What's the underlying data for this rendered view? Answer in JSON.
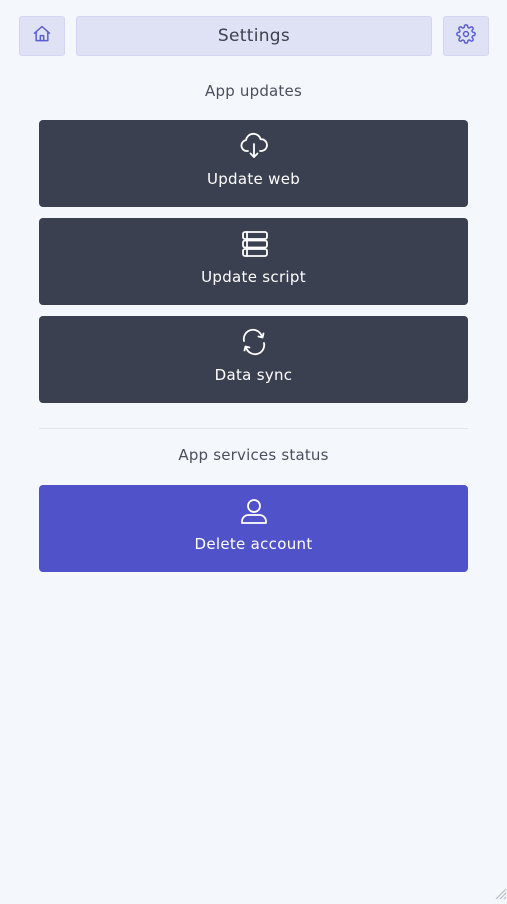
{
  "header": {
    "title": "Settings",
    "home_icon": "home-icon",
    "settings_icon": "gear-icon"
  },
  "sections": {
    "app_updates_title": "App updates",
    "services_status_title": "App services status"
  },
  "actions": [
    {
      "label": "Update web",
      "icon": "cloud-download-icon"
    },
    {
      "label": "Update script",
      "icon": "database-icon"
    },
    {
      "label": "Data sync",
      "icon": "sync-icon"
    }
  ],
  "account": {
    "delete_label": "Delete account",
    "icon": "user-icon"
  },
  "colors": {
    "background": "#f4f7fb",
    "header_bg": "#dfe1f5",
    "card_dark": "#3a4050",
    "card_primary": "#5052c9",
    "accent": "#5a5fd0"
  }
}
